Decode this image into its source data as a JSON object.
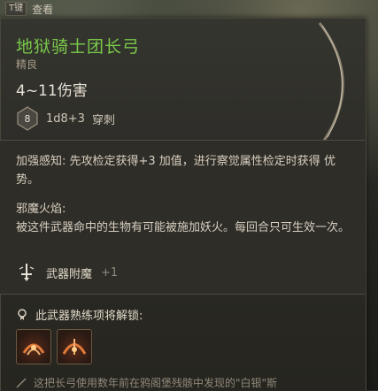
{
  "topbar": {
    "key": "T键",
    "label": "查看"
  },
  "item": {
    "name": "地狱骑士团长弓",
    "rarity": "精良",
    "damage": "4~11伤害",
    "dice_label": "8",
    "dice_formula": "1d8+3",
    "damage_type": "穿刺"
  },
  "ability1": {
    "text": "加强感知: 先攻检定获得+3 加值，进行察觉属性检定时获得 优势。"
  },
  "ability2": {
    "title": "邪魔火焰:",
    "text": "被这件武器命中的生物有可能被施加妖火。每回合只可生效一次。"
  },
  "enchant": {
    "label": "武器附魔",
    "bonus": "+1"
  },
  "proficiency": {
    "label": "此武器熟练项将解锁:"
  },
  "description": {
    "text": "这把长弓使用数年前在鸦阁堡残骸中发现的\"白银\"斯"
  },
  "colors": {
    "title": "#79c94a",
    "panel": "#2c2b27"
  }
}
